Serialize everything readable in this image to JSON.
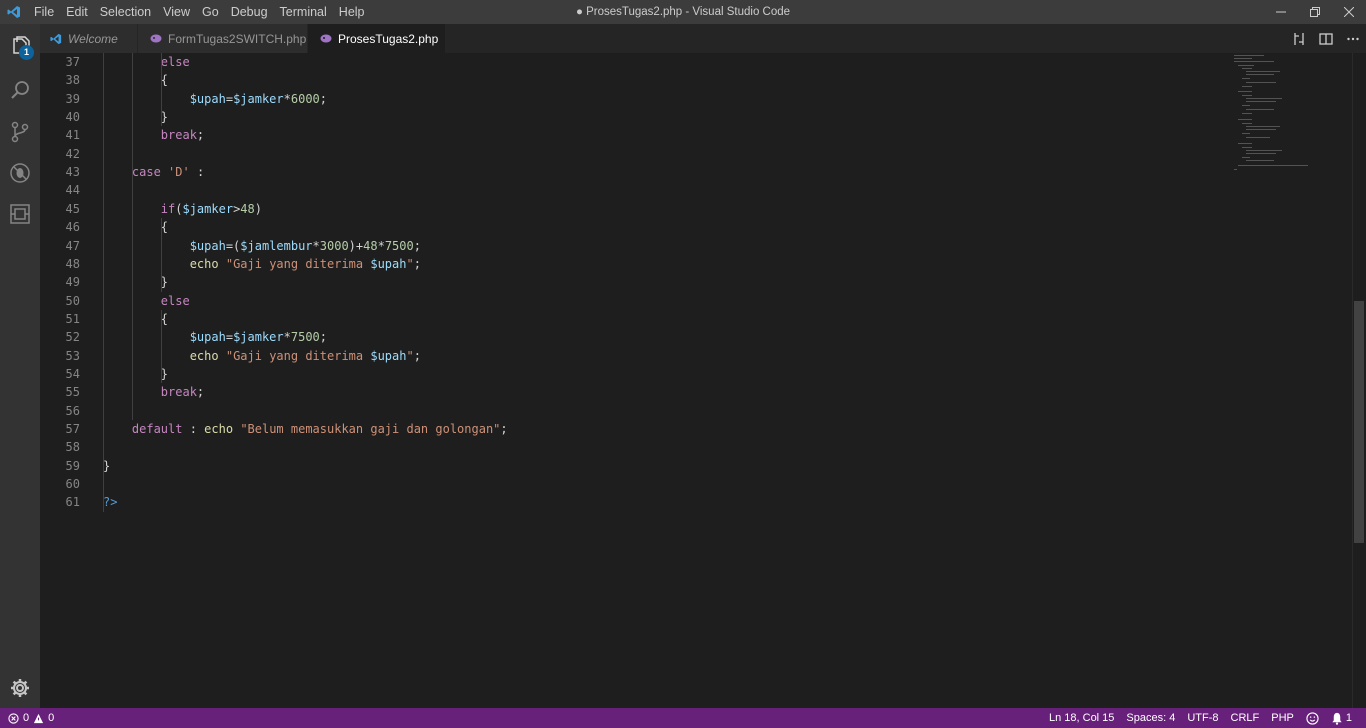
{
  "window": {
    "title": "● ProsesTugas2.php - Visual Studio Code",
    "menu": [
      "File",
      "Edit",
      "Selection",
      "View",
      "Go",
      "Debug",
      "Terminal",
      "Help"
    ]
  },
  "activity": {
    "explorer_badge": "1",
    "items": [
      "files-icon",
      "search-icon",
      "source-control-icon",
      "debug-icon",
      "extensions-icon"
    ]
  },
  "tabs": [
    {
      "label": "Welcome",
      "icon": "vscode-icon",
      "italic": true
    },
    {
      "label": "FormTugas2SWITCH.php",
      "icon": "php-icon",
      "italic": false
    },
    {
      "label": "ProsesTugas2.php",
      "icon": "php-icon",
      "italic": false,
      "active": true,
      "dirty": true
    }
  ],
  "editor": {
    "lines": [
      {
        "n": "37",
        "code": "        <span class=\"kw\">else</span>"
      },
      {
        "n": "38",
        "code": "        {"
      },
      {
        "n": "39",
        "code": "            <span class=\"var\">$upah</span>=<span class=\"var\">$jamker</span>*<span class=\"num\">6000</span>;"
      },
      {
        "n": "40",
        "code": "        }"
      },
      {
        "n": "41",
        "code": "        <span class=\"kw\">break</span>;"
      },
      {
        "n": "42",
        "code": ""
      },
      {
        "n": "43",
        "code": "    <span class=\"kw\">case</span> <span class=\"str\">'D'</span> :"
      },
      {
        "n": "44",
        "code": ""
      },
      {
        "n": "45",
        "code": "        <span class=\"kw\">if</span>(<span class=\"var\">$jamker</span>&gt;<span class=\"num\">48</span>)"
      },
      {
        "n": "46",
        "code": "        {"
      },
      {
        "n": "47",
        "code": "            <span class=\"var\">$upah</span>=(<span class=\"var\">$jamlembur</span>*<span class=\"num\">3000</span>)+<span class=\"num\">48</span>*<span class=\"num\">7500</span>;"
      },
      {
        "n": "48",
        "code": "            <span class=\"fn\">echo</span> <span class=\"str\">\"Gaji yang diterima </span><span class=\"var\">$upah</span><span class=\"str\">\"</span>;"
      },
      {
        "n": "49",
        "code": "        }"
      },
      {
        "n": "50",
        "code": "        <span class=\"kw\">else</span>"
      },
      {
        "n": "51",
        "code": "        {"
      },
      {
        "n": "52",
        "code": "            <span class=\"var\">$upah</span>=<span class=\"var\">$jamker</span>*<span class=\"num\">7500</span>;"
      },
      {
        "n": "53",
        "code": "            <span class=\"fn\">echo</span> <span class=\"str\">\"Gaji yang diterima </span><span class=\"var\">$upah</span><span class=\"str\">\"</span>;"
      },
      {
        "n": "54",
        "code": "        }"
      },
      {
        "n": "55",
        "code": "        <span class=\"kw\">break</span>;"
      },
      {
        "n": "56",
        "code": ""
      },
      {
        "n": "57",
        "code": "    <span class=\"kw\">default</span> : <span class=\"fn\">echo</span> <span class=\"str\">\"Belum memasukkan gaji dan golongan\"</span>;"
      },
      {
        "n": "58",
        "code": ""
      },
      {
        "n": "59",
        "code": "}"
      },
      {
        "n": "60",
        "code": ""
      },
      {
        "n": "61",
        "code": "<span class=\"tag\">?&gt;</span>"
      }
    ]
  },
  "status": {
    "errors": "0",
    "warnings": "0",
    "position": "Ln 18, Col 15",
    "spaces": "Spaces: 4",
    "encoding": "UTF-8",
    "eol": "CRLF",
    "language": "PHP",
    "notifications": "1"
  }
}
